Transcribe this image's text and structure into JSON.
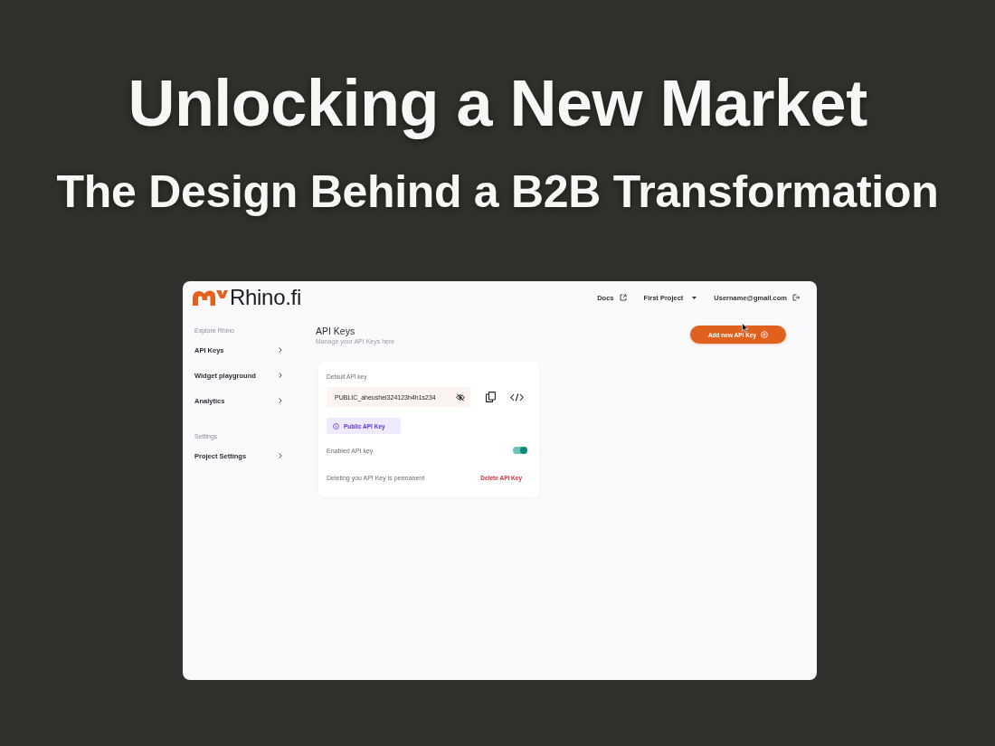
{
  "headline": {
    "title": "Unlocking a New Market",
    "subtitle": "The Design Behind a B2B Transformation"
  },
  "app": {
    "logo": "Rhino.fi",
    "nav": [
      {
        "label": "Docs",
        "kind": "external"
      },
      {
        "label": "First Project",
        "kind": "dropdown"
      },
      {
        "label": "Username@gmail.com",
        "kind": "logout"
      }
    ],
    "sidebar": [
      {
        "heading": "Explore Rhino",
        "items": [
          "API Keys",
          "Widget playground",
          "Analytics"
        ]
      },
      {
        "heading": "Settings",
        "items": [
          "Project Settings"
        ]
      }
    ],
    "page": {
      "title": "API Keys",
      "subtitle": "Manage your API Keys here",
      "action": "Add new API Key"
    },
    "key_card": {
      "label": "Default API key",
      "value": "PUBLIC_aheushei324123h4h1s234",
      "tag": "Public API Key",
      "toggle": {
        "label": "Enabled API key",
        "on": true
      },
      "warning": "Deleting you API Key is permanent",
      "delete_action": "Delete API Key"
    }
  }
}
